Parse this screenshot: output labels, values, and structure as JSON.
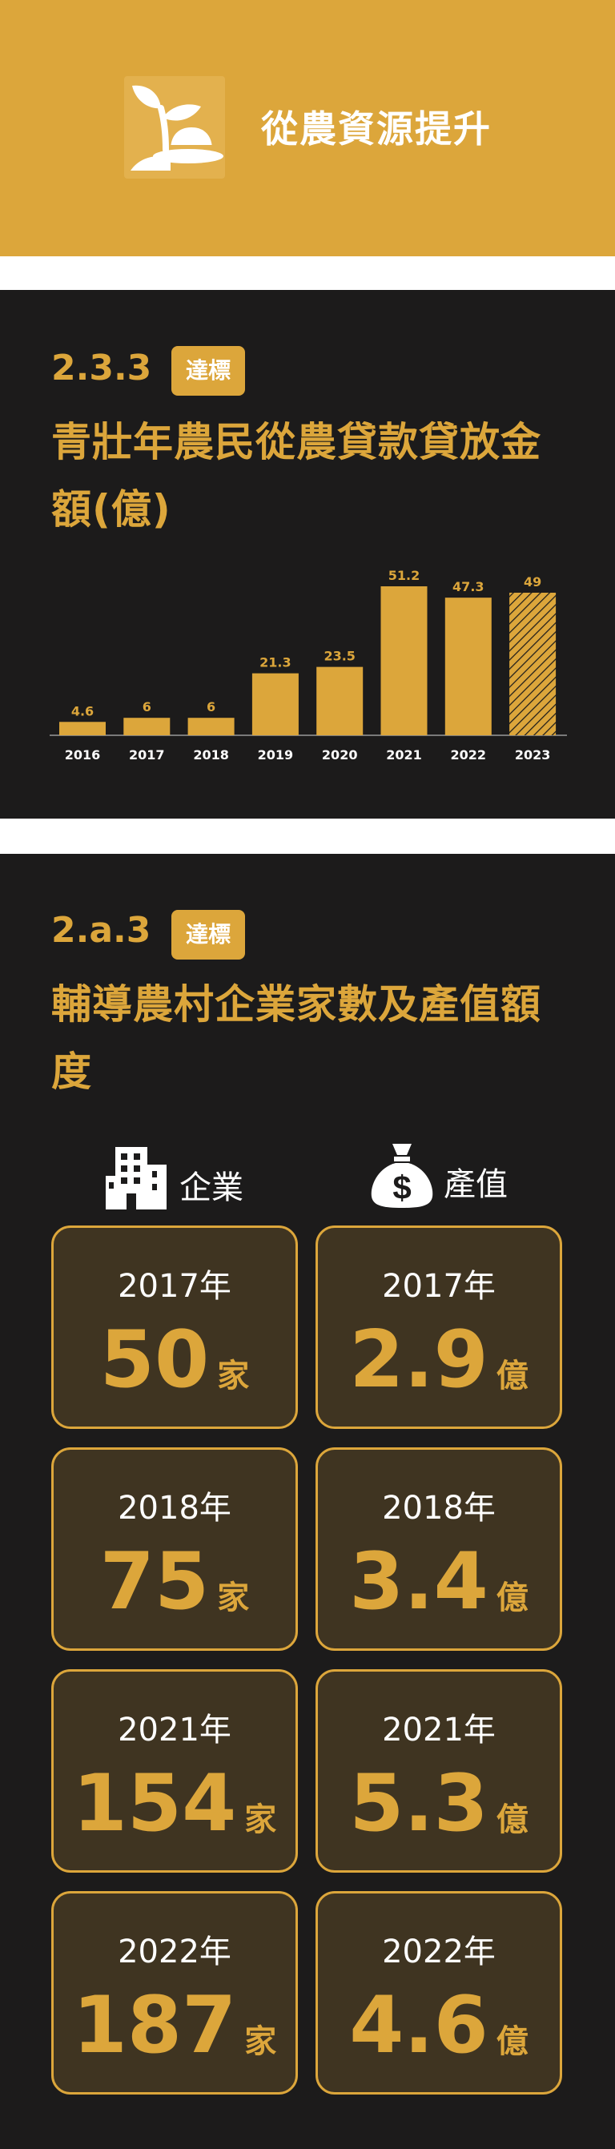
{
  "header": {
    "title": "從農資源提升",
    "logo_icon": "sprout-hat-icon"
  },
  "section1": {
    "number": "2.3.3",
    "badge": "達標",
    "title_line1": "青壯年農民從農貸款貸放金",
    "title_line2": "額(億)"
  },
  "chart_data": {
    "type": "bar",
    "categories": [
      "2016",
      "2017",
      "2018",
      "2019",
      "2020",
      "2021",
      "2022",
      "2023"
    ],
    "values": [
      4.6,
      6,
      6,
      21.3,
      23.5,
      51.2,
      47.3,
      49
    ],
    "value_labels": [
      "4.6",
      "6",
      "6",
      "21.3",
      "23.5",
      "51.2",
      "47.3",
      "49"
    ],
    "hatched_category": "2023",
    "title": "",
    "xlabel": "",
    "ylabel": "",
    "ylim": [
      0,
      60
    ],
    "grid": false,
    "bar_color": "#dca63b"
  },
  "section2": {
    "number": "2.a.3",
    "badge": "達標",
    "title_line1": "輔導農村企業家數及產值額",
    "title_line2": "度",
    "col_enterprise": {
      "label": "企業",
      "icon": "building-icon"
    },
    "col_value": {
      "label": "產值",
      "icon": "money-bag-icon"
    },
    "rows": [
      {
        "year": "2017年",
        "count": "50",
        "count_unit": "家",
        "value": "2.9",
        "value_unit": "億"
      },
      {
        "year": "2018年",
        "count": "75",
        "count_unit": "家",
        "value": "3.4",
        "value_unit": "億"
      },
      {
        "year": "2021年",
        "count": "154",
        "count_unit": "家",
        "value": "5.3",
        "value_unit": "億"
      },
      {
        "year": "2022年",
        "count": "187",
        "count_unit": "家",
        "value": "4.6",
        "value_unit": "億"
      }
    ]
  },
  "colors": {
    "accent": "#dca63b",
    "dark_bg": "#1c1b1b",
    "card_bg": "#3f3421"
  }
}
